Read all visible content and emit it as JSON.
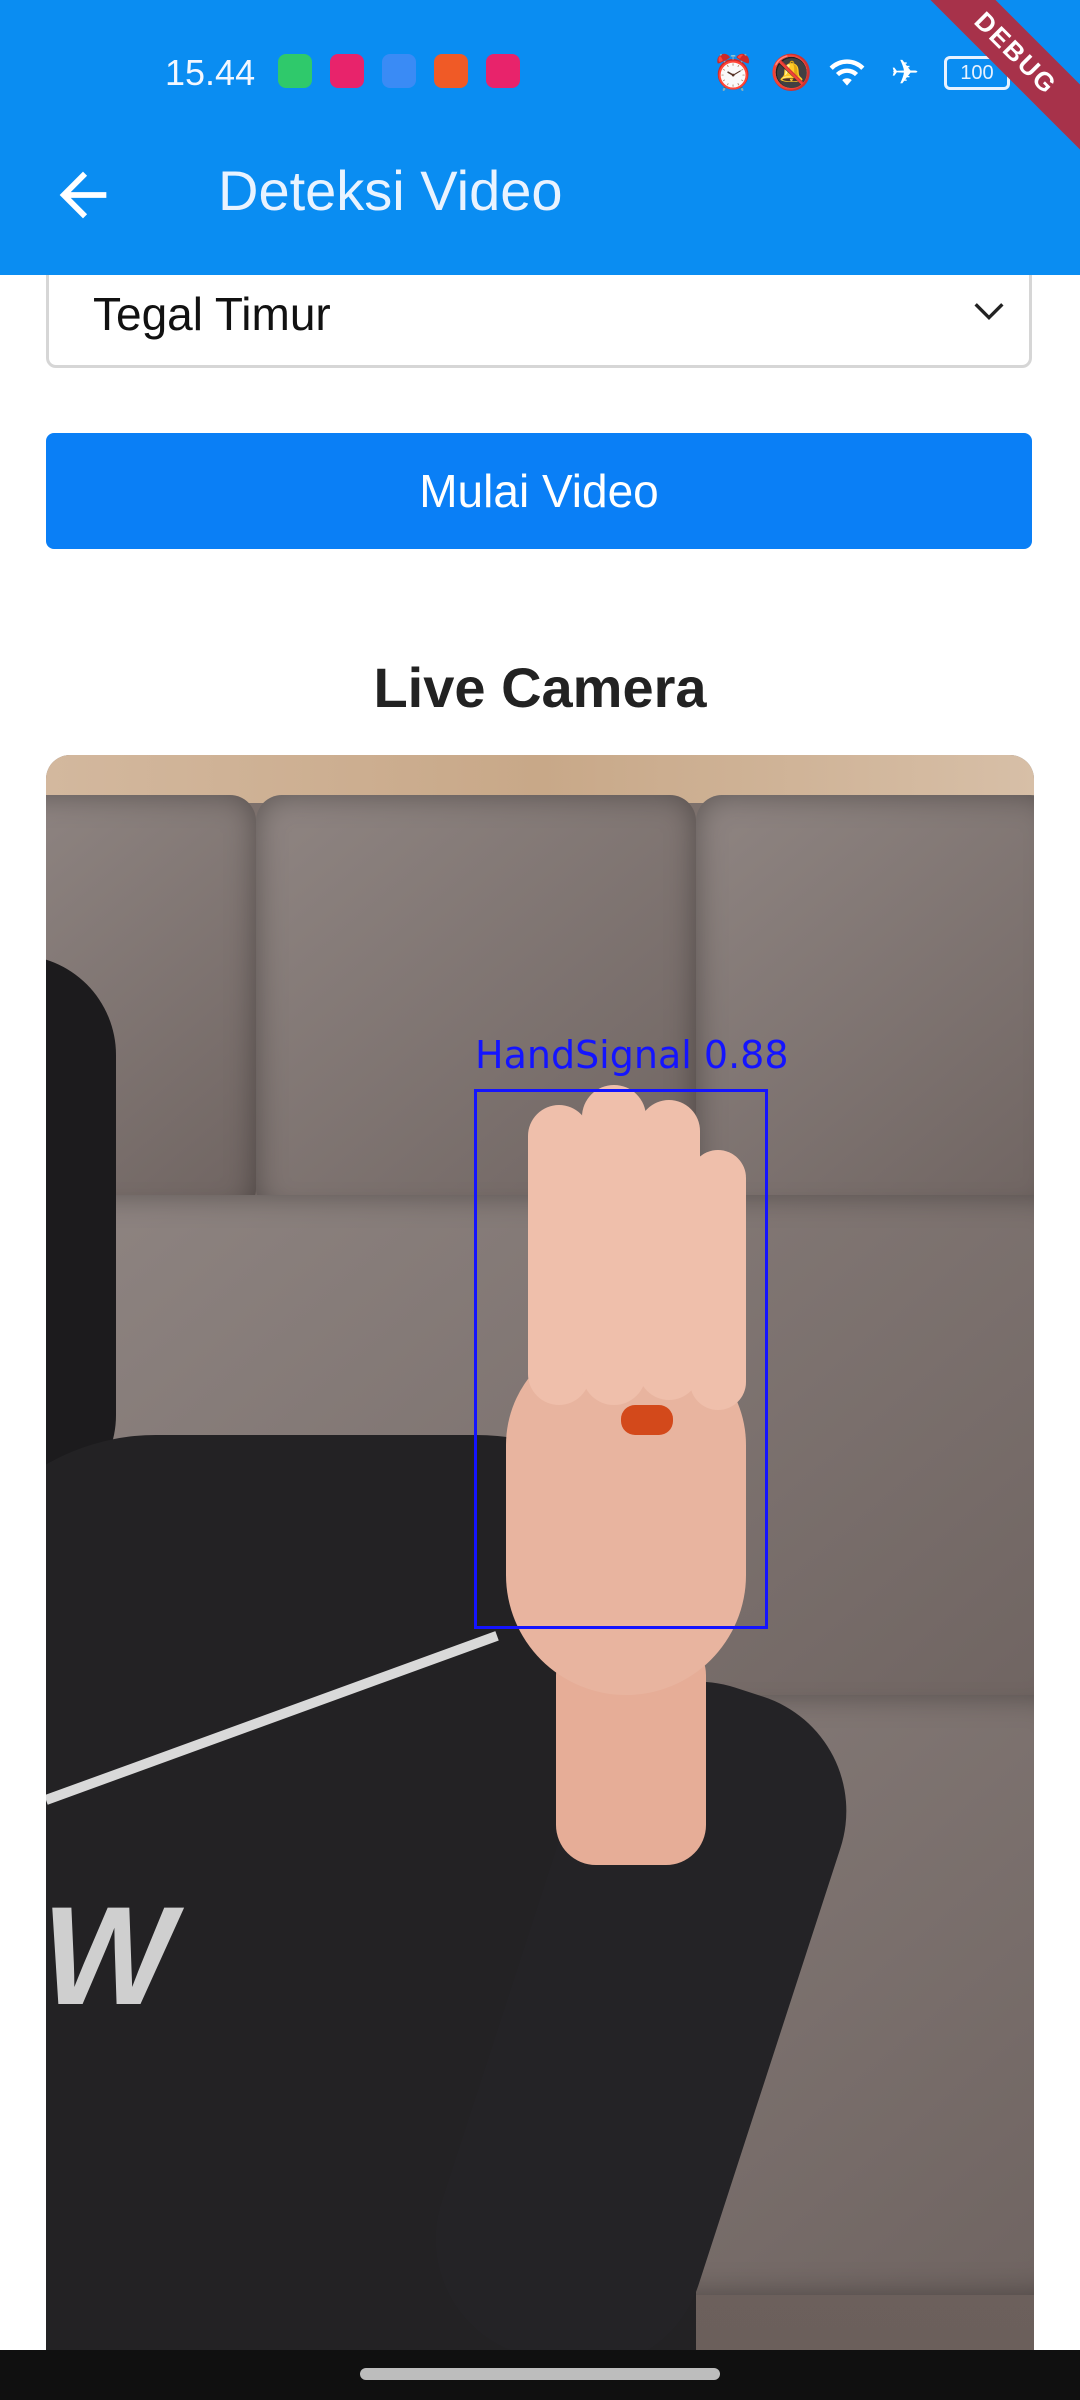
{
  "status_bar": {
    "time": "15.44",
    "notification_icons": [
      "battery-saver-icon",
      "lazada-icon",
      "weather-icon",
      "shopee-icon",
      "lazada-icon"
    ],
    "right_icons": [
      "alarm-icon",
      "mute-icon",
      "wifi-icon",
      "airplane-mode-icon"
    ],
    "battery": "100"
  },
  "debug_banner": "DEBUG",
  "app_bar": {
    "title": "Deteksi Video",
    "back_icon": "arrow-back-icon"
  },
  "location_dropdown": {
    "selected": "Tegal Timur"
  },
  "start_button": {
    "label": "Mulai Video"
  },
  "camera_section": {
    "title": "Live Camera",
    "detection": {
      "label": "HandSignal",
      "confidence": "0.88"
    }
  },
  "colors": {
    "app_bar": "#0a8df2",
    "button": "#0a7ff6",
    "detection_box": "#1414ff"
  }
}
